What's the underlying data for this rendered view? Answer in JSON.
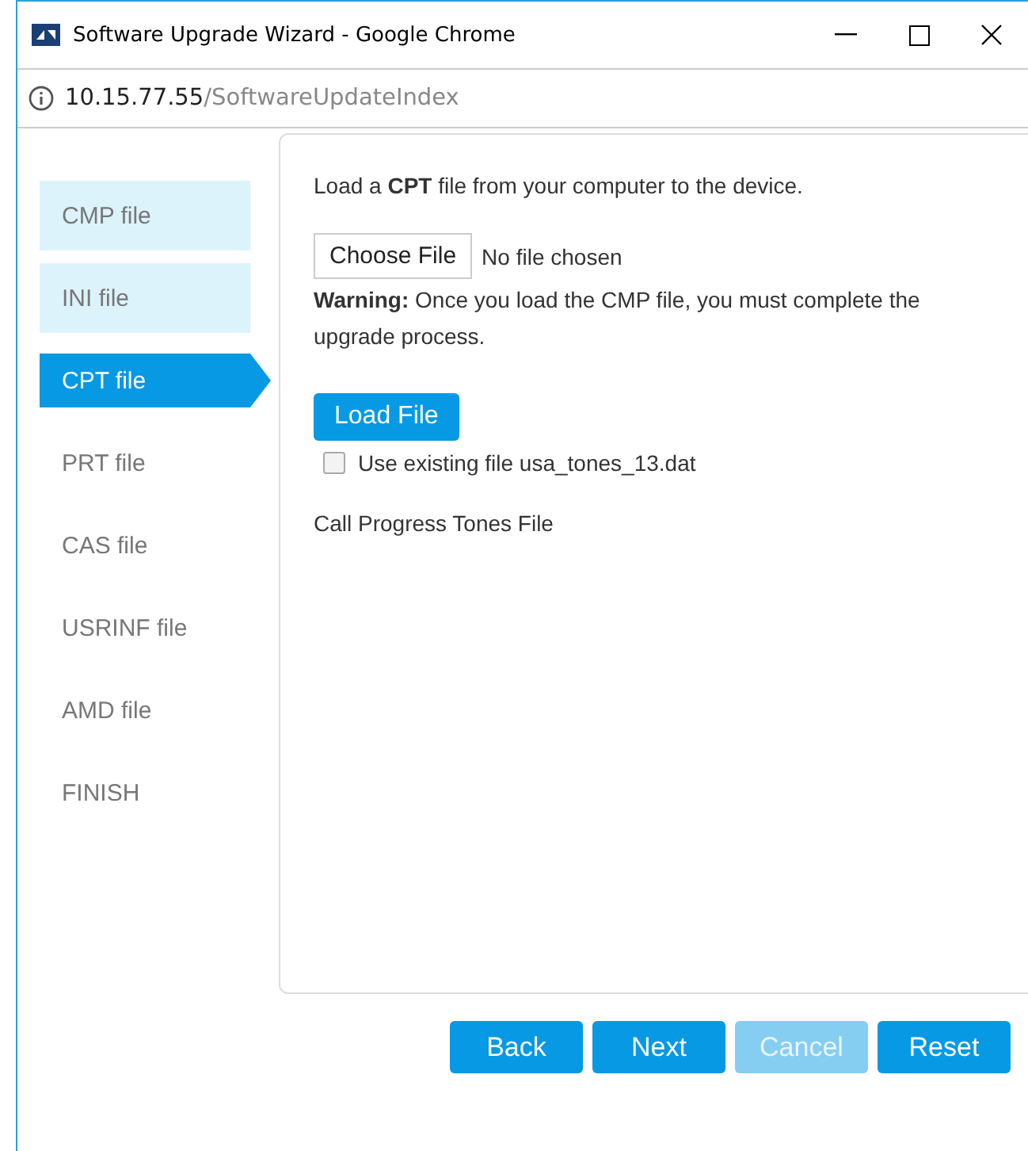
{
  "window": {
    "title": "Software Upgrade Wizard - Google Chrome"
  },
  "address_bar": {
    "host": "10.15.77.55",
    "path": "/SoftwareUpdateIndex"
  },
  "steps": [
    {
      "label": "CMP file",
      "done": true,
      "selected": false
    },
    {
      "label": "INI file",
      "done": true,
      "selected": false
    },
    {
      "label": "CPT file",
      "done": false,
      "selected": true
    },
    {
      "label": "PRT file",
      "done": false,
      "selected": false
    },
    {
      "label": "CAS file",
      "done": false,
      "selected": false
    },
    {
      "label": "USRINF file",
      "done": false,
      "selected": false
    },
    {
      "label": "AMD file",
      "done": false,
      "selected": false
    },
    {
      "label": "FINISH",
      "done": false,
      "selected": false
    }
  ],
  "panel": {
    "intro": "Load a **CPT** file from your computer to the device.",
    "choose_button": "Choose File",
    "file_status": "No file chosen",
    "warning": "**Warning:** Once you load the CMP file, you must complete the upgrade process.",
    "load_button": "Load File",
    "use_existing": {
      "label": "Use existing file usa_tones_13.dat",
      "checked": false
    },
    "description": "Call Progress Tones File"
  },
  "buttons": [
    {
      "label": "Back",
      "disabled": false
    },
    {
      "label": "Next",
      "disabled": false
    },
    {
      "label": "Cancel",
      "disabled": true
    },
    {
      "label": "Reset",
      "disabled": false
    }
  ]
}
